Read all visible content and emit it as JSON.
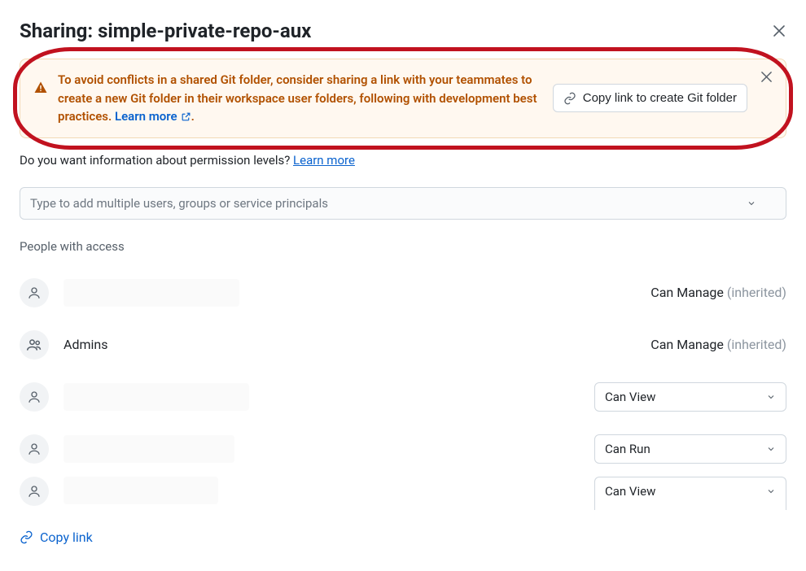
{
  "dialog": {
    "title_prefix": "Sharing: ",
    "title_name": "simple-private-repo-aux"
  },
  "banner": {
    "text": "To avoid conflicts in a shared Git folder, consider sharing a link with your teammates to create a new Git folder in their workspace user folders, following with development best practices. ",
    "learn_more": "Learn more",
    "copy_button": "Copy link to create Git folder"
  },
  "perm_info": {
    "text": "Do you want information about permission levels? ",
    "link": "Learn more"
  },
  "add_principal": {
    "placeholder": "Type to add multiple users, groups or service principals"
  },
  "access": {
    "heading": "People with access",
    "rows": [
      {
        "type": "user",
        "name": "",
        "redact_width": 216,
        "perm": "Can Manage",
        "inherited": true,
        "control": "static"
      },
      {
        "type": "group",
        "name": "Admins",
        "redact_width": 0,
        "perm": "Can Manage",
        "inherited": true,
        "control": "static"
      },
      {
        "type": "user",
        "name": "",
        "redact_width": 228,
        "perm": "Can View",
        "inherited": false,
        "control": "select"
      },
      {
        "type": "user",
        "name": "",
        "redact_width": 210,
        "perm": "Can Run",
        "inherited": false,
        "control": "select"
      },
      {
        "type": "user",
        "name": "",
        "redact_width": 190,
        "perm": "Can View",
        "inherited": false,
        "control": "select_cut"
      }
    ]
  },
  "footer": {
    "copy_link": "Copy link"
  },
  "labels": {
    "inherited_suffix": " (inherited)"
  }
}
